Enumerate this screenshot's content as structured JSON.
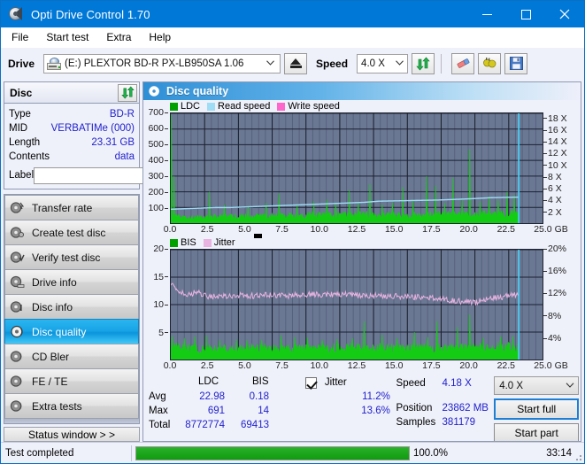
{
  "window": {
    "title": "Opti Drive Control 1.70",
    "icon": "disc-icon",
    "minimize": "minimize-icon",
    "maximize": "maximize-icon",
    "close": "close-icon"
  },
  "menu": {
    "items": [
      {
        "label": "File"
      },
      {
        "label": "Start test"
      },
      {
        "label": "Extra"
      },
      {
        "label": "Help"
      }
    ]
  },
  "toolbar": {
    "drive_label": "Drive",
    "drive_value": "(E:)   PLEXTOR BD-R  PX-LB950SA 1.06",
    "eject_icon": "eject-icon",
    "speed_label": "Speed",
    "speed_value": "4.0 X",
    "refresh_icon": "refresh-icon",
    "eraser_icon": "eraser-icon",
    "plugs_icon": "plugs-icon",
    "save_icon": "save-icon"
  },
  "disc_panel": {
    "title": "Disc",
    "refresh_icon": "refresh-icon",
    "rows": [
      {
        "key": "Type",
        "value": "BD-R"
      },
      {
        "key": "MID",
        "value": "VERBATIMe (000)"
      },
      {
        "key": "Length",
        "value": "23.31 GB"
      },
      {
        "key": "Contents",
        "value": "data"
      }
    ],
    "label_key": "Label",
    "label_value": "",
    "label_placeholder": "",
    "label_button_icon": "disc-label-icon"
  },
  "sidebar": {
    "items": [
      {
        "label": "Transfer rate",
        "icon": "disc-transfer-icon",
        "selected": false
      },
      {
        "label": "Create test disc",
        "icon": "disc-create-icon",
        "selected": false
      },
      {
        "label": "Verify test disc",
        "icon": "disc-verify-icon",
        "selected": false
      },
      {
        "label": "Drive info",
        "icon": "disc-drive-icon",
        "selected": false
      },
      {
        "label": "Disc info",
        "icon": "disc-info-icon",
        "selected": false
      },
      {
        "label": "Disc quality",
        "icon": "disc-quality-icon",
        "selected": true
      },
      {
        "label": "CD Bler",
        "icon": "disc-bler-icon",
        "selected": false
      },
      {
        "label": "FE / TE",
        "icon": "disc-fete-icon",
        "selected": false
      },
      {
        "label": "Extra tests",
        "icon": "disc-extra-icon",
        "selected": false
      }
    ],
    "status_window_button": "Status window > >"
  },
  "main": {
    "header_title": "Disc quality",
    "header_icon": "disc-quality-icon"
  },
  "chart_data": [
    {
      "type": "area",
      "id": "ldc-chart",
      "title": "",
      "legend": [
        {
          "label": "LDC",
          "color": "#00a000"
        },
        {
          "label": "Read speed",
          "color": "#9fdcf5"
        },
        {
          "label": "Write speed",
          "color": "#ff66cc"
        }
      ],
      "legend_position": "top-left",
      "xlabel": "GB",
      "xlim": [
        0,
        25.0
      ],
      "xticks": [
        "0.0",
        "2.5",
        "5.0",
        "7.5",
        "10.0",
        "12.5",
        "15.0",
        "17.5",
        "20.0",
        "22.5",
        "25.0"
      ],
      "xtick_values": [
        0,
        2.5,
        5.0,
        7.5,
        10.0,
        12.5,
        15.0,
        17.5,
        20.0,
        22.5,
        25.0
      ],
      "ylabel_left": "LDC",
      "ylim": [
        0,
        700
      ],
      "yticks": [
        100,
        200,
        300,
        400,
        500,
        600,
        700
      ],
      "ylabel_right": "Speed",
      "y2lim": [
        0,
        19
      ],
      "y2ticks": [
        "2 X",
        "4 X",
        "6 X",
        "8 X",
        "10 X",
        "12 X",
        "14 X",
        "16 X",
        "18 X"
      ],
      "y2tick_values": [
        2,
        4,
        6,
        8,
        10,
        12,
        14,
        16,
        18
      ],
      "grid": true,
      "series": [
        {
          "name": "LDC",
          "color": "#15cc15",
          "kind": "area",
          "baseline_x": [
            0.0,
            1.0,
            2.0,
            3.0,
            4.0,
            5.0,
            6.0,
            7.0,
            8.0,
            9.0,
            10.0,
            11.0,
            12.0,
            13.0,
            14.0,
            15.0,
            16.0,
            17.0,
            18.0,
            19.0,
            20.0,
            21.0,
            22.0,
            23.0,
            23.3
          ],
          "baseline_y": [
            40,
            35,
            35,
            40,
            40,
            42,
            42,
            45,
            45,
            48,
            55,
            50,
            50,
            52,
            50,
            50,
            48,
            50,
            55,
            55,
            50,
            55,
            58,
            60,
            58
          ],
          "spikes": [
            {
              "x": 0.05,
              "y": 691
            },
            {
              "x": 0.22,
              "y": 300
            },
            {
              "x": 2.6,
              "y": 200
            },
            {
              "x": 3.6,
              "y": 120
            },
            {
              "x": 5.2,
              "y": 110
            },
            {
              "x": 6.4,
              "y": 130
            },
            {
              "x": 7.3,
              "y": 190
            },
            {
              "x": 8.5,
              "y": 120
            },
            {
              "x": 9.6,
              "y": 140
            },
            {
              "x": 10.5,
              "y": 150
            },
            {
              "x": 11.1,
              "y": 125
            },
            {
              "x": 12.0,
              "y": 210
            },
            {
              "x": 12.6,
              "y": 135
            },
            {
              "x": 13.4,
              "y": 250
            },
            {
              "x": 14.2,
              "y": 120
            },
            {
              "x": 14.9,
              "y": 130
            },
            {
              "x": 15.6,
              "y": 230
            },
            {
              "x": 16.3,
              "y": 150
            },
            {
              "x": 17.2,
              "y": 300
            },
            {
              "x": 17.8,
              "y": 240
            },
            {
              "x": 18.4,
              "y": 130
            },
            {
              "x": 19.0,
              "y": 290
            },
            {
              "x": 19.6,
              "y": 150
            },
            {
              "x": 20.1,
              "y": 470
            },
            {
              "x": 20.8,
              "y": 140
            },
            {
              "x": 21.4,
              "y": 170
            },
            {
              "x": 22.0,
              "y": 150
            },
            {
              "x": 22.6,
              "y": 200
            },
            {
              "x": 23.1,
              "y": 180
            }
          ]
        },
        {
          "name": "Read speed",
          "color": "#9fdcf5",
          "kind": "line",
          "x": [
            0.0,
            1.0,
            2.0,
            3.0,
            4.0,
            5.0,
            6.0,
            8.0,
            10.0,
            12.0,
            13.0,
            14.0,
            16.0,
            18.0,
            20.0,
            21.5,
            23.3
          ],
          "y": [
            2.4,
            2.5,
            2.6,
            2.7,
            2.7,
            2.8,
            2.9,
            3.1,
            3.3,
            3.5,
            3.6,
            3.8,
            3.9,
            4.0,
            4.2,
            4.4,
            4.5
          ]
        },
        {
          "name": "End marker",
          "color": "#44d7ff",
          "kind": "vline",
          "x": 23.4
        }
      ]
    },
    {
      "type": "area",
      "id": "bis-jitter-chart",
      "title": "",
      "legend": [
        {
          "label": "BIS",
          "color": "#00a000"
        },
        {
          "label": "Jitter",
          "color": "#e8b3e0"
        }
      ],
      "legend_position": "top-left",
      "xlabel": "GB",
      "xlim": [
        0,
        25.0
      ],
      "xticks": [
        "0.0",
        "2.5",
        "5.0",
        "7.5",
        "10.0",
        "12.5",
        "15.0",
        "17.5",
        "20.0",
        "22.5",
        "25.0"
      ],
      "xtick_values": [
        0,
        2.5,
        5.0,
        7.5,
        10.0,
        12.5,
        15.0,
        17.5,
        20.0,
        22.5,
        25.0
      ],
      "ylabel_left": "BIS",
      "ylim": [
        0,
        20
      ],
      "yticks": [
        5,
        10,
        15,
        20
      ],
      "ylabel_right": "Jitter",
      "y2lim": [
        0,
        20
      ],
      "y2ticks": [
        "4%",
        "8%",
        "12%",
        "16%",
        "20%"
      ],
      "y2tick_values": [
        4,
        8,
        12,
        16,
        20
      ],
      "grid": true,
      "series": [
        {
          "name": "BIS",
          "color": "#15cc15",
          "kind": "area",
          "baseline_x": [
            0.0,
            2.0,
            4.0,
            6.0,
            8.0,
            10.0,
            12.0,
            14.0,
            16.0,
            18.0,
            20.0,
            22.0,
            23.3
          ],
          "baseline_y": [
            2.2,
            1.9,
            1.9,
            2.0,
            2.0,
            2.0,
            2.1,
            2.0,
            2.0,
            2.1,
            2.0,
            2.2,
            2.3
          ],
          "spikes": [
            {
              "x": 0.1,
              "y": 4.3
            },
            {
              "x": 0.9,
              "y": 3.9
            },
            {
              "x": 1.6,
              "y": 4.2
            },
            {
              "x": 2.4,
              "y": 4.4
            },
            {
              "x": 3.3,
              "y": 3.6
            },
            {
              "x": 4.4,
              "y": 3.6
            },
            {
              "x": 5.1,
              "y": 3.5
            },
            {
              "x": 6.1,
              "y": 3.6
            },
            {
              "x": 7.4,
              "y": 4.4
            },
            {
              "x": 8.3,
              "y": 4.1
            },
            {
              "x": 9.2,
              "y": 4.0
            },
            {
              "x": 10.2,
              "y": 3.6
            },
            {
              "x": 11.2,
              "y": 3.7
            },
            {
              "x": 12.2,
              "y": 3.9
            },
            {
              "x": 13.0,
              "y": 7.0
            },
            {
              "x": 14.2,
              "y": 4.5
            },
            {
              "x": 15.2,
              "y": 3.9
            },
            {
              "x": 16.4,
              "y": 5.0
            },
            {
              "x": 17.3,
              "y": 4.1
            },
            {
              "x": 17.9,
              "y": 7.0
            },
            {
              "x": 19.3,
              "y": 5.9
            },
            {
              "x": 20.1,
              "y": 8.2
            },
            {
              "x": 21.0,
              "y": 4.0
            },
            {
              "x": 22.2,
              "y": 4.2
            },
            {
              "x": 23.0,
              "y": 4.3
            }
          ]
        },
        {
          "name": "Jitter",
          "color": "#e8b3e0",
          "kind": "line",
          "x": [
            0.0,
            0.3,
            1.0,
            1.8,
            2.5,
            3.5,
            4.5,
            5.5,
            6.5,
            7.5,
            8.5,
            9.5,
            10.5,
            11.5,
            12.5,
            13.5,
            14.5,
            15.5,
            16.5,
            17.5,
            18.5,
            19.5,
            20.5,
            21.3,
            22.0,
            22.8,
            23.3
          ],
          "y": [
            14.0,
            12.9,
            11.8,
            12.3,
            11.5,
            11.6,
            11.7,
            11.6,
            11.8,
            11.6,
            11.7,
            11.9,
            11.8,
            11.9,
            11.7,
            11.6,
            11.6,
            11.5,
            11.4,
            11.2,
            10.9,
            10.6,
            10.4,
            11.2,
            11.3,
            11.6,
            11.9
          ]
        },
        {
          "name": "End marker",
          "color": "#44d7ff",
          "kind": "vline",
          "x": 23.4
        }
      ]
    }
  ],
  "stats": {
    "columns": [
      "LDC",
      "BIS"
    ],
    "rows": [
      {
        "label": "Avg",
        "ldc": "22.98",
        "bis": "0.18",
        "jitter": "11.2%"
      },
      {
        "label": "Max",
        "ldc": "691",
        "bis": "14",
        "jitter": "13.6%"
      },
      {
        "label": "Total",
        "ldc": "8772774",
        "bis": "69413",
        "jitter": ""
      }
    ],
    "jitter_label": "Jitter",
    "jitter_checked": true,
    "speed_label": "Speed",
    "speed_value": "4.18 X",
    "position_label": "Position",
    "position_value": "23862 MB",
    "samples_label": "Samples",
    "samples_value": "381179",
    "speed_select": "4.0 X",
    "start_full_button": "Start full",
    "start_part_button": "Start part"
  },
  "statusbar": {
    "message": "Test completed",
    "progress_percent": 100.0,
    "progress_text": "100.0%",
    "elapsed": "33:14"
  },
  "colors": {
    "accent": "#0078d7",
    "value_blue": "#2222cc",
    "ldc_green": "#15cc15",
    "plot_bg": "#6b7894",
    "jitter_pink": "#e8b3e0",
    "read_speed_blue": "#9fdcf5"
  }
}
